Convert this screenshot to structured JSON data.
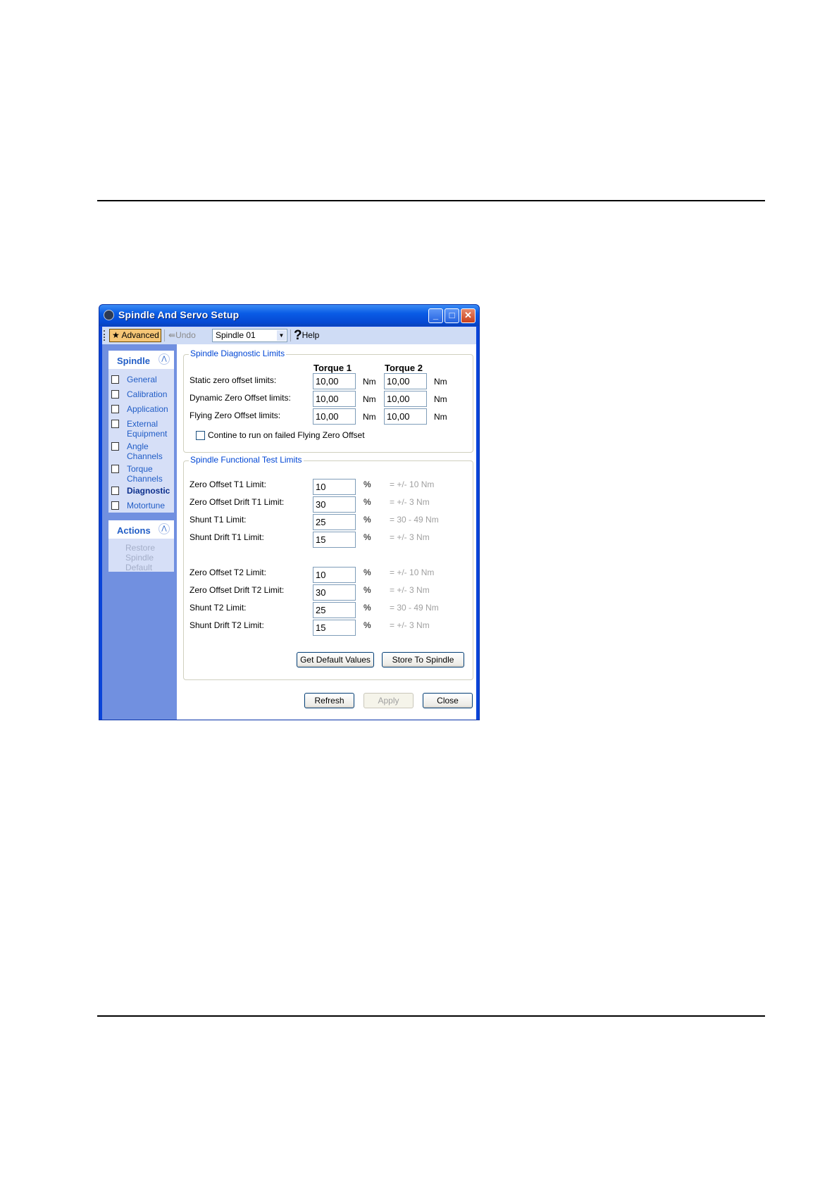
{
  "window": {
    "title": "Spindle And Servo Setup",
    "controls": {
      "minimize": "_",
      "maximize": "□",
      "close": "✕"
    }
  },
  "toolbar": {
    "advanced_label": "Advanced",
    "undo_label": "Undo",
    "spindle_select": "Spindle 01",
    "help_label": "Help",
    "help_glyph": "?"
  },
  "sidebar": {
    "spindle_header": "Spindle",
    "items": [
      {
        "line1": "General",
        "line2": ""
      },
      {
        "line1": "Calibration",
        "line2": ""
      },
      {
        "line1": "Application",
        "line2": ""
      },
      {
        "line1": "External",
        "line2": "Equipment"
      },
      {
        "line1": "Angle",
        "line2": "Channels"
      },
      {
        "line1": "Torque",
        "line2": "Channels"
      },
      {
        "line1": "Diagnostic",
        "line2": ""
      },
      {
        "line1": "Motortune",
        "line2": ""
      }
    ],
    "actions_header": "Actions",
    "actions": {
      "line1": "Restore",
      "line2": "Spindle",
      "line3": "Default"
    }
  },
  "diagnostic": {
    "title": "Spindle Diagnostic Limits",
    "col1": "Torque 1",
    "col2": "Torque 2",
    "unit": "Nm",
    "rows": [
      {
        "label": "Static zero offset limits:",
        "t1": "10,00",
        "t2": "10,00"
      },
      {
        "label": "Dynamic Zero Offset limits:",
        "t1": "10,00",
        "t2": "10,00"
      },
      {
        "label": "Flying Zero Offset limits:",
        "t1": "10,00",
        "t2": "10,00"
      }
    ],
    "checkbox_label": "Contine to run on failed Flying Zero Offset",
    "checkbox_checked": false
  },
  "functional": {
    "title": "Spindle Functional Test Limits",
    "unit": "%",
    "rows": [
      {
        "label": "Zero Offset T1 Limit:",
        "value": "10",
        "hint": "= +/- 10 Nm"
      },
      {
        "label": "Zero Offset Drift T1 Limit:",
        "value": "30",
        "hint": "= +/- 3 Nm"
      },
      {
        "label": "Shunt T1 Limit:",
        "value": "25",
        "hint": "= 30 - 49 Nm"
      },
      {
        "label": "Shunt Drift T1 Limit:",
        "value": "15",
        "hint": "= +/- 3 Nm"
      },
      {
        "label": "Zero Offset T2 Limit:",
        "value": "10",
        "hint": "= +/- 10 Nm"
      },
      {
        "label": "Zero Offset Drift T2 Limit:",
        "value": "30",
        "hint": "= +/- 3 Nm"
      },
      {
        "label": "Shunt T2 Limit:",
        "value": "25",
        "hint": "= 30 - 49 Nm"
      },
      {
        "label": "Shunt Drift T2 Limit:",
        "value": "15",
        "hint": "= +/- 3 Nm"
      }
    ],
    "get_defaults": "Get Default Values",
    "store": "Store To Spindle"
  },
  "footer": {
    "refresh": "Refresh",
    "apply": "Apply",
    "close": "Close"
  },
  "colors": {
    "window_frame": "#0a44d8",
    "sidebar_bg": "#7190e0",
    "link_blue": "#215dc6",
    "group_title": "#0046d5"
  }
}
